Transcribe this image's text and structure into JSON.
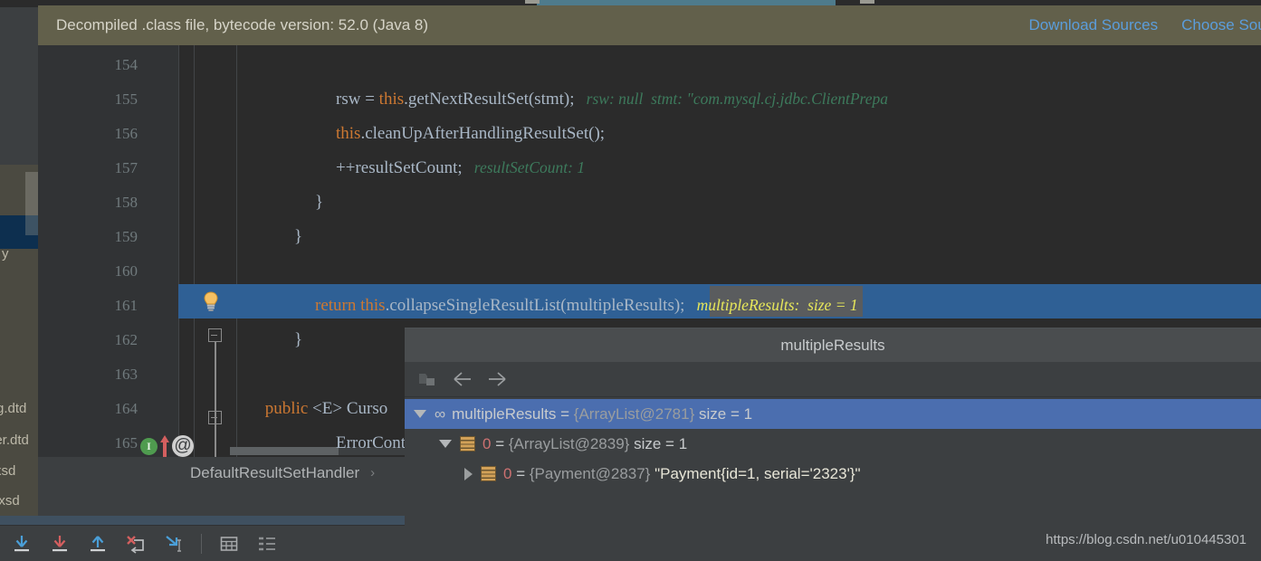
{
  "banner": {
    "message": "Decompiled .class file, bytecode version: 52.0 (Java 8)",
    "download_sources_label": "Download Sources",
    "choose_sources_label": "Choose Sources...",
    "bg_color": "#62604b",
    "link_color": "#5b9ddb"
  },
  "left_panel": {
    "items": [
      {
        "label": "y"
      },
      {
        "label": "g.dtd"
      },
      {
        "label": "per.dtd"
      },
      {
        "label": "xsd"
      },
      {
        "label": "r.xsd"
      }
    ]
  },
  "editor": {
    "first_line": 154,
    "selected_line": 161,
    "lines": [
      {
        "num": "154",
        "segments": []
      },
      {
        "num": "155",
        "segments": [
          {
            "text": "rsw = ",
            "cls": "plain"
          },
          {
            "text": "this",
            "cls": "kw"
          },
          {
            "text": ".getNextResultSet(stmt);",
            "cls": "plain"
          },
          {
            "text": "   rsw: null  stmt: \"com.mysql.cj.jdbc.ClientPrepa",
            "cls": "hint"
          }
        ]
      },
      {
        "num": "156",
        "segments": [
          {
            "text": "this",
            "cls": "kw"
          },
          {
            "text": ".cleanUpAfterHandlingResultSet();",
            "cls": "plain"
          }
        ]
      },
      {
        "num": "157",
        "segments": [
          {
            "text": "++resultSetCount;",
            "cls": "plain"
          },
          {
            "text": "   resultSetCount: 1",
            "cls": "hint"
          }
        ]
      },
      {
        "num": "158",
        "segments": [
          {
            "text": "}",
            "cls": "plain"
          }
        ]
      },
      {
        "num": "159",
        "segments": [
          {
            "text": "}",
            "cls": "plain"
          }
        ]
      },
      {
        "num": "160",
        "segments": []
      },
      {
        "num": "161",
        "segments": [
          {
            "text": "return ",
            "cls": "kw"
          },
          {
            "text": "this",
            "cls": "kw"
          },
          {
            "text": ".collapseSingleResultList(multipleResults);",
            "cls": "plain"
          },
          {
            "text": "   multipleResults:  size = 1",
            "cls": "hint-sel"
          }
        ]
      },
      {
        "num": "162",
        "segments": [
          {
            "text": "}",
            "cls": "plain"
          }
        ]
      },
      {
        "num": "163",
        "segments": []
      },
      {
        "num": "164",
        "segments": [
          {
            "text": "public ",
            "cls": "kw"
          },
          {
            "text": "<E> Curso",
            "cls": "plain"
          }
        ]
      },
      {
        "num": "165",
        "segments": [
          {
            "text": "ErrorContext",
            "cls": "plain"
          }
        ]
      }
    ],
    "line_161_code_before": "return ",
    "line_161_this": "this",
    "line_161_mid": ".collapseSingleResultList(",
    "line_161_token": "multipleResults",
    "line_161_after": ");",
    "line_161_hint": "multipleResults:  size = 1",
    "gutter_icons": {
      "bulb": "lightbulb-icon",
      "implement": "I",
      "annotation": "@"
    },
    "selection_color": "#2f6095",
    "token_highlight_color": "#5a5c5e"
  },
  "breadcrumb": {
    "class_name": "DefaultResultSetHandler",
    "separator": "›"
  },
  "popup": {
    "title": "multipleResults",
    "toolbar": [
      {
        "name": "copy-value-icon",
        "label": ""
      },
      {
        "name": "back-arrow-icon",
        "label": "←"
      },
      {
        "name": "forward-arrow-icon",
        "label": "→"
      }
    ],
    "tree": [
      {
        "indent": 0,
        "expanded": true,
        "selected": true,
        "icon": "variable-icon",
        "icon_glyph": "∞",
        "name": "multipleResults",
        "eq": " = ",
        "ref": "{ArrayList@2781}",
        "extra": " size = 1",
        "value": ""
      },
      {
        "indent": 1,
        "expanded": true,
        "selected": false,
        "icon": "list-icon",
        "icon_glyph": "",
        "name": "0",
        "eq": " = ",
        "ref": "{ArrayList@2839}",
        "extra": " size = 1",
        "value": ""
      },
      {
        "indent": 2,
        "expanded": false,
        "selected": false,
        "icon": "list-icon",
        "icon_glyph": "",
        "name": "0",
        "eq": " = ",
        "ref": "{Payment@2837}",
        "extra": "",
        "value": "\"Payment{id=1, serial='2323'}\""
      }
    ]
  },
  "debug_toolbar": {
    "buttons": [
      {
        "name": "step-over-button",
        "color": "#4a9fd8"
      },
      {
        "name": "step-into-button",
        "color": "#d35f5f"
      },
      {
        "name": "step-out-button",
        "color": "#4a9fd8"
      },
      {
        "name": "force-step-into-button",
        "color": "#d35f5f"
      },
      {
        "name": "run-to-cursor-button",
        "color": "#4a9fd8"
      },
      {
        "name": "evaluate-expression-button",
        "color": "#9a9d9f"
      },
      {
        "name": "show-execution-point-button",
        "color": "#9a9d9f"
      }
    ]
  },
  "watermark": {
    "url": "https://blog.csdn.net/u010445301"
  }
}
